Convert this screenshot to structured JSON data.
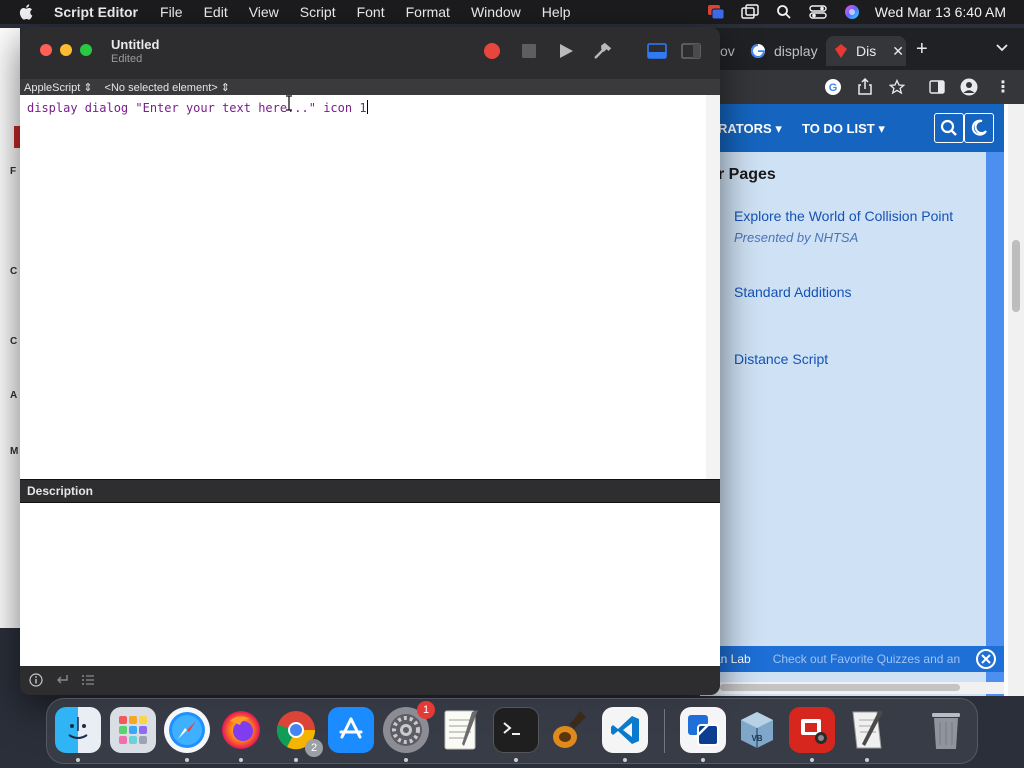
{
  "menubar": {
    "app_name": "Script Editor",
    "items": [
      "File",
      "Edit",
      "View",
      "Script",
      "Font",
      "Format",
      "Window",
      "Help"
    ],
    "clock": "Wed Mar 13  6:40 AM",
    "status_icons": [
      "screen-share-icon",
      "window-icon",
      "search-icon",
      "control-center-icon",
      "siri-icon"
    ]
  },
  "editor": {
    "title": "Untitled",
    "subtitle": "Edited",
    "language": "AppleScript",
    "language_chevron": "⇕",
    "element_selector": "<No selected element>",
    "element_chevron": "⇕",
    "code": "display dialog \"Enter your text here...\" icon 1",
    "description_label": "Description",
    "toolbar": [
      "record-button",
      "stop-button",
      "run-button",
      "compile-button",
      "log-pane-toggle",
      "sidebar-toggle"
    ]
  },
  "chrome": {
    "tabs": [
      {
        "label": "ov"
      },
      {
        "label": "display"
      },
      {
        "label": "Dis"
      }
    ],
    "new_tab": "+",
    "site_nav": {
      "item1": "RATORS",
      "item2": "TO DO LIST"
    },
    "heading": "r Pages",
    "links": [
      {
        "title": "Explore the World of Collision Point",
        "subtitle": "Presented by NHTSA"
      },
      {
        "title": "Standard Additions"
      },
      {
        "title": "Distance Script"
      }
    ],
    "banner_left": "an Lab",
    "banner_text": "Check out Favorite Quizzes and an"
  },
  "left_strip_chars": [
    "F",
    "C",
    "C",
    "A",
    "M"
  ],
  "dock": {
    "apps": [
      {
        "name": "Finder"
      },
      {
        "name": "Launchpad"
      },
      {
        "name": "Safari"
      },
      {
        "name": "Firefox"
      },
      {
        "name": "Chrome",
        "badge": "2"
      },
      {
        "name": "App Store"
      },
      {
        "name": "System Settings",
        "badge": "1"
      },
      {
        "name": "TextEdit"
      },
      {
        "name": "Terminal"
      },
      {
        "name": "GarageBand"
      },
      {
        "name": "Visual Studio Code"
      },
      {
        "name": "Screen Sharing"
      },
      {
        "name": "VirtualBox"
      },
      {
        "name": "Photo Booth"
      },
      {
        "name": "Script Editor"
      },
      {
        "name": "Trash"
      }
    ]
  },
  "colors": {
    "menubar_bg": "#1c1c1e",
    "editor_bg": "#2a2a2c",
    "code_color": "#7a1f8c",
    "close": "#ff5f57",
    "minimize": "#febc2e",
    "zoom": "#28c840",
    "record": "#e8453c",
    "toggle_active": "#2f7bf5",
    "site_nav": "#1565c0",
    "site_content": "#cfe2f5",
    "link": "#1552b5"
  }
}
